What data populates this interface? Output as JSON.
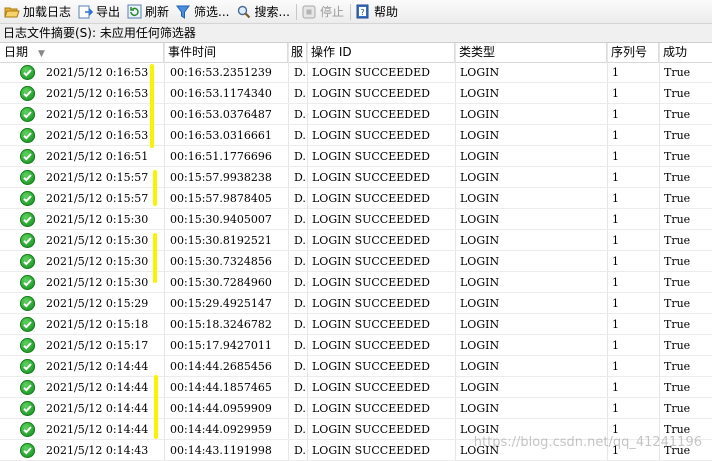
{
  "toolbar": {
    "load_log": "加载日志",
    "export": "导出",
    "refresh": "刷新",
    "filter": "筛选...",
    "search": "搜索...",
    "stop": "停止",
    "help": "帮助"
  },
  "summary": "日志文件摘要(S): 未应用任何筛选器",
  "columns": {
    "date": "日期",
    "event_time": "事件时间",
    "server": "服",
    "operation_id": "操作 ID",
    "class_type": "类类型",
    "sequence": "序列号",
    "succeeded": "成功"
  },
  "rows": [
    {
      "date": "2021/5/12 0:16:53",
      "time": "00:16:53.2351239",
      "server": "D.",
      "op": "LOGIN SUCCEEDED",
      "class": "LOGIN",
      "seq": "1",
      "ok": "True"
    },
    {
      "date": "2021/5/12 0:16:53",
      "time": "00:16:53.1174340",
      "server": "D.",
      "op": "LOGIN SUCCEEDED",
      "class": "LOGIN",
      "seq": "1",
      "ok": "True"
    },
    {
      "date": "2021/5/12 0:16:53",
      "time": "00:16:53.0376487",
      "server": "D.",
      "op": "LOGIN SUCCEEDED",
      "class": "LOGIN",
      "seq": "1",
      "ok": "True"
    },
    {
      "date": "2021/5/12 0:16:53",
      "time": "00:16:53.0316661",
      "server": "D.",
      "op": "LOGIN SUCCEEDED",
      "class": "LOGIN",
      "seq": "1",
      "ok": "True"
    },
    {
      "date": "2021/5/12 0:16:51",
      "time": "00:16:51.1776696",
      "server": "D.",
      "op": "LOGIN SUCCEEDED",
      "class": "LOGIN",
      "seq": "1",
      "ok": "True"
    },
    {
      "date": "2021/5/12 0:15:57",
      "time": "00:15:57.9938238",
      "server": "D.",
      "op": "LOGIN SUCCEEDED",
      "class": "LOGIN",
      "seq": "1",
      "ok": "True"
    },
    {
      "date": "2021/5/12 0:15:57",
      "time": "00:15:57.9878405",
      "server": "D.",
      "op": "LOGIN SUCCEEDED",
      "class": "LOGIN",
      "seq": "1",
      "ok": "True"
    },
    {
      "date": "2021/5/12 0:15:30",
      "time": "00:15:30.9405007",
      "server": "D.",
      "op": "LOGIN SUCCEEDED",
      "class": "LOGIN",
      "seq": "1",
      "ok": "True"
    },
    {
      "date": "2021/5/12 0:15:30",
      "time": "00:15:30.8192521",
      "server": "D.",
      "op": "LOGIN SUCCEEDED",
      "class": "LOGIN",
      "seq": "1",
      "ok": "True"
    },
    {
      "date": "2021/5/12 0:15:30",
      "time": "00:15:30.7324856",
      "server": "D.",
      "op": "LOGIN SUCCEEDED",
      "class": "LOGIN",
      "seq": "1",
      "ok": "True"
    },
    {
      "date": "2021/5/12 0:15:30",
      "time": "00:15:30.7284960",
      "server": "D.",
      "op": "LOGIN SUCCEEDED",
      "class": "LOGIN",
      "seq": "1",
      "ok": "True"
    },
    {
      "date": "2021/5/12 0:15:29",
      "time": "00:15:29.4925147",
      "server": "D.",
      "op": "LOGIN SUCCEEDED",
      "class": "LOGIN",
      "seq": "1",
      "ok": "True"
    },
    {
      "date": "2021/5/12 0:15:18",
      "time": "00:15:18.3246782",
      "server": "D.",
      "op": "LOGIN SUCCEEDED",
      "class": "LOGIN",
      "seq": "1",
      "ok": "True"
    },
    {
      "date": "2021/5/12 0:15:17",
      "time": "00:15:17.9427011",
      "server": "D.",
      "op": "LOGIN SUCCEEDED",
      "class": "LOGIN",
      "seq": "1",
      "ok": "True"
    },
    {
      "date": "2021/5/12 0:14:44",
      "time": "00:14:44.2685456",
      "server": "D.",
      "op": "LOGIN SUCCEEDED",
      "class": "LOGIN",
      "seq": "1",
      "ok": "True"
    },
    {
      "date": "2021/5/12 0:14:44",
      "time": "00:14:44.1857465",
      "server": "D.",
      "op": "LOGIN SUCCEEDED",
      "class": "LOGIN",
      "seq": "1",
      "ok": "True"
    },
    {
      "date": "2021/5/12 0:14:44",
      "time": "00:14:44.0959909",
      "server": "D.",
      "op": "LOGIN SUCCEEDED",
      "class": "LOGIN",
      "seq": "1",
      "ok": "True"
    },
    {
      "date": "2021/5/12 0:14:44",
      "time": "00:14:44.0929959",
      "server": "D.",
      "op": "LOGIN SUCCEEDED",
      "class": "LOGIN",
      "seq": "1",
      "ok": "True"
    },
    {
      "date": "2021/5/12 0:14:43",
      "time": "00:14:43.1191998",
      "server": "D.",
      "op": "LOGIN SUCCEEDED",
      "class": "LOGIN",
      "seq": "1",
      "ok": "True"
    }
  ],
  "watermark": "https://blog.csdn.net/qq_41241196",
  "icons": {
    "load_log": "folder-open-icon",
    "export": "export-icon",
    "refresh": "refresh-icon",
    "filter": "funnel-icon",
    "search": "magnifier-icon",
    "stop": "stop-icon",
    "help": "help-book-icon",
    "status": "success-check-icon"
  },
  "colors": {
    "success": "#1f9a2a",
    "highlight": "#f5f500",
    "accent": "#2a6fd6"
  }
}
